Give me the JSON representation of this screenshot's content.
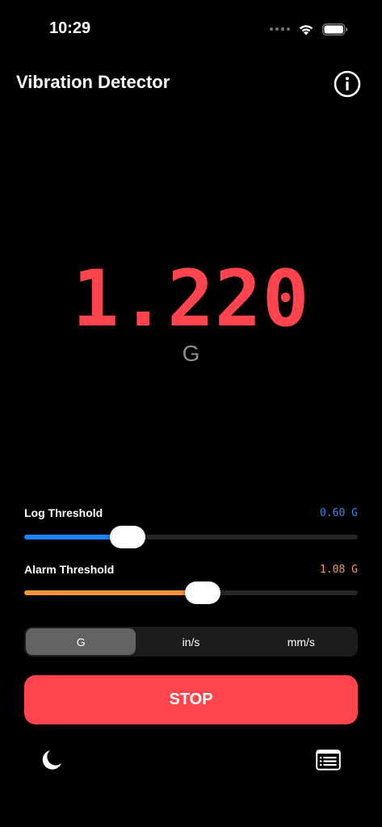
{
  "status_bar": {
    "time": "10:29",
    "icons": [
      "cellular-dots-icon",
      "wifi-icon",
      "battery-icon"
    ]
  },
  "header": {
    "title": "Vibration Detector",
    "info_icon": "info-icon"
  },
  "reading": {
    "value": "1.220",
    "unit": "G",
    "color": "#ff444d"
  },
  "log_threshold": {
    "label": "Log Threshold",
    "value_text": "0.60 G",
    "fraction": 0.31,
    "color": "#1a86ff"
  },
  "alarm_threshold": {
    "label": "Alarm Threshold",
    "value_text": "1.08 G",
    "fraction": 0.535,
    "color": "#f7913a"
  },
  "units": {
    "options": [
      "G",
      "in/s",
      "mm/s"
    ],
    "selected": "G"
  },
  "stop_button": {
    "label": "STOP",
    "color": "#ff444d"
  },
  "footer": {
    "left_icon": "moon-icon",
    "right_icon": "log-list-icon"
  }
}
